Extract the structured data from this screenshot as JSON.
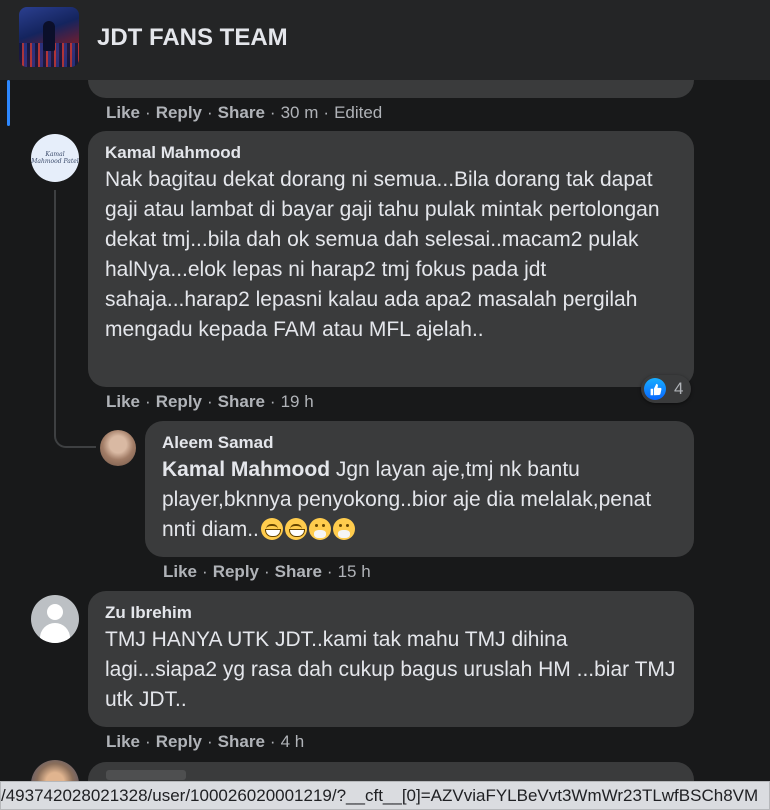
{
  "group": {
    "name": "JDT FANS TEAM"
  },
  "actions": {
    "like": "Like",
    "reply": "Reply",
    "share": "Share",
    "separator": "·"
  },
  "previous_comment": {
    "time": "30 m",
    "edited": "Edited"
  },
  "comments": [
    {
      "author": "Kamal Mahmood",
      "avatar_text": "Kamal Mahmood Patel",
      "text": "Nak bagitau dekat dorang ni semua...Bila dorang tak dapat gaji atau lambat di bayar gaji tahu pulak mintak pertolongan dekat tmj...bila dah ok semua dah selesai..macam2 pulak halNya...elok lepas ni harap2 tmj fokus pada jdt sahaja...harap2 lepasni kalau ada apa2 masalah pergilah mengadu kepada FAM atau MFL ajelah..",
      "time": "19 h",
      "reactions": {
        "type": "like",
        "count": "4"
      },
      "replies": [
        {
          "author": "Aleem Samad",
          "mention": "Kamal Mahmood",
          "text": " Jgn layan aje,tmj nk bantu player,bknnya penyokong..bior aje dia melalak,penat nnti diam..",
          "emojis": [
            "grinning-face",
            "grinning-face",
            "hushed-face",
            "hushed-face"
          ],
          "time": "15 h"
        }
      ]
    },
    {
      "author": "Zu Ibrehim",
      "text": "TMJ HANYA UTK JDT..kami tak mahu TMJ dihina lagi...siapa2 yg rasa dah cukup bagus uruslah HM ...biar TMJ utk JDT..",
      "time": "4 h"
    }
  ],
  "status_bar": {
    "url": "/493742028021328/user/100026020001219/?__cft__[0]=AZVviaFYLBeVvt3WmWr23TLwfBSCh8VM"
  },
  "colors": {
    "background": "#18191a",
    "bubble": "#3a3b3c",
    "secondary_text": "#b0b3b8",
    "like_blue": "#0866ff"
  }
}
